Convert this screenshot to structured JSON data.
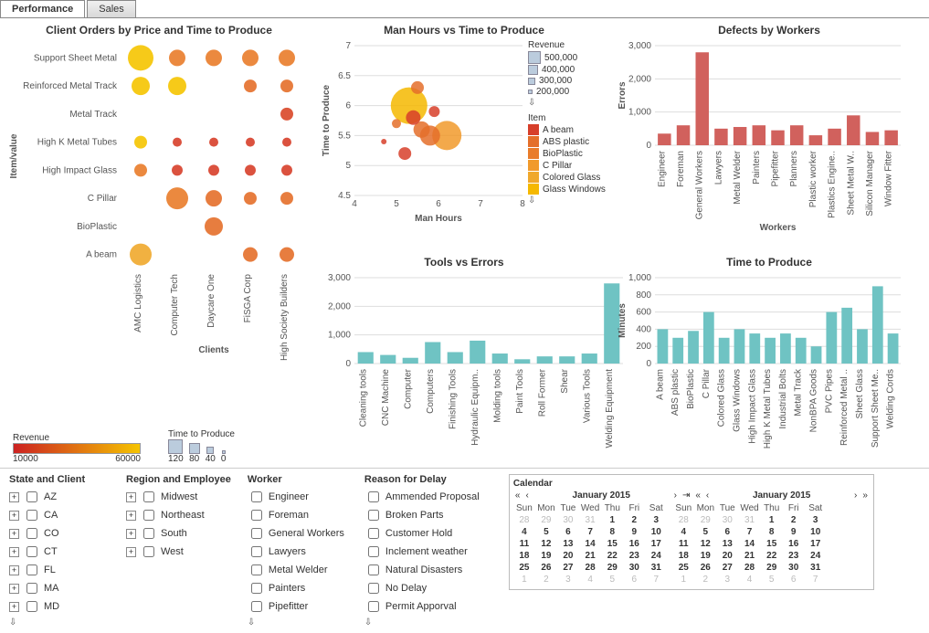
{
  "tabs": {
    "performance": "Performance",
    "sales": "Sales"
  },
  "chart_data": [
    {
      "id": "man_hours_vs_time",
      "type": "scatter",
      "title": "Man Hours vs Time to Produce",
      "xlabel": "Man Hours",
      "ylabel": "Time to Produce",
      "xlim": [
        4,
        8
      ],
      "ylim": [
        4.5,
        7
      ],
      "xticks": [
        4,
        5,
        6,
        7,
        8
      ],
      "yticks": [
        4.5,
        5,
        5.5,
        6,
        6.5,
        7
      ],
      "size_field": "Revenue",
      "size_legend": [
        500000,
        400000,
        300000,
        200000
      ],
      "color_field": "Item",
      "color_legend": [
        "A beam",
        "ABS plastic",
        "BioPlastic",
        "C Pillar",
        "Colored Glass",
        "Glass Windows"
      ],
      "points": [
        {
          "x": 5.3,
          "y": 6.0,
          "r": 20,
          "c": "#f5b800"
        },
        {
          "x": 5.6,
          "y": 5.6,
          "r": 9,
          "c": "#e46f2a"
        },
        {
          "x": 5.4,
          "y": 5.8,
          "r": 8,
          "c": "#d73f2a"
        },
        {
          "x": 5.0,
          "y": 5.7,
          "r": 5,
          "c": "#e46f2a"
        },
        {
          "x": 6.2,
          "y": 5.5,
          "r": 16,
          "c": "#f19a2c"
        },
        {
          "x": 5.8,
          "y": 5.5,
          "r": 11,
          "c": "#e46f2a"
        },
        {
          "x": 5.2,
          "y": 5.2,
          "r": 7,
          "c": "#d73f2a"
        },
        {
          "x": 4.7,
          "y": 5.4,
          "r": 3,
          "c": "#d73f2a"
        },
        {
          "x": 5.5,
          "y": 6.3,
          "r": 7,
          "c": "#e46f2a"
        },
        {
          "x": 5.9,
          "y": 5.9,
          "r": 6,
          "c": "#d73f2a"
        }
      ]
    },
    {
      "id": "defects_by_workers",
      "type": "bar",
      "title": "Defects by Workers",
      "xlabel": "Workers",
      "ylabel": "Errors",
      "ylim": [
        0,
        3000
      ],
      "yticks": [
        0,
        1000,
        2000,
        3000
      ],
      "categories": [
        "Engineer",
        "Foreman",
        "General Workers",
        "Lawyers",
        "Metal Welder",
        "Painters",
        "Pipefitter",
        "Planners",
        "Plastic worker",
        "Plastics Engine..",
        "Sheet Metal W..",
        "Silicon Manager",
        "Window Fitter"
      ],
      "values": [
        350,
        600,
        2800,
        500,
        550,
        600,
        450,
        600,
        300,
        500,
        900,
        400,
        450
      ],
      "color": "#d1615d"
    },
    {
      "id": "client_orders",
      "type": "scatter",
      "title": "Client Orders by Price and Time to Produce",
      "xlabel": "Clients",
      "ylabel": "Item/value",
      "y_categories": [
        "Support Sheet Metal",
        "Reinforced Metal Track",
        "Metal Track",
        "High K Metal Tubes",
        "High Impact Glass",
        "C Pillar",
        "BioPlastic",
        "A beam"
      ],
      "x_categories": [
        "AMC Logistics",
        "Computer Tech",
        "Daycare One",
        "FiSGA Corp",
        "High Society Builders"
      ],
      "points": [
        {
          "yi": 0,
          "xi": 0,
          "r": 14,
          "c": "#f5c400"
        },
        {
          "yi": 0,
          "xi": 1,
          "r": 9,
          "c": "#e97c2a"
        },
        {
          "yi": 0,
          "xi": 2,
          "r": 9,
          "c": "#e97c2a"
        },
        {
          "yi": 0,
          "xi": 3,
          "r": 9,
          "c": "#e97c2a"
        },
        {
          "yi": 0,
          "xi": 4,
          "r": 9,
          "c": "#e97c2a"
        },
        {
          "yi": 1,
          "xi": 0,
          "r": 10,
          "c": "#f5c400"
        },
        {
          "yi": 1,
          "xi": 1,
          "r": 10,
          "c": "#f5c400"
        },
        {
          "yi": 1,
          "xi": 3,
          "r": 7,
          "c": "#e46f2a"
        },
        {
          "yi": 1,
          "xi": 4,
          "r": 7,
          "c": "#e46f2a"
        },
        {
          "yi": 2,
          "xi": 4,
          "r": 7,
          "c": "#d94728"
        },
        {
          "yi": 3,
          "xi": 0,
          "r": 7,
          "c": "#f5c400"
        },
        {
          "yi": 3,
          "xi": 1,
          "r": 5,
          "c": "#d73f2a"
        },
        {
          "yi": 3,
          "xi": 2,
          "r": 5,
          "c": "#d73f2a"
        },
        {
          "yi": 3,
          "xi": 3,
          "r": 5,
          "c": "#d73f2a"
        },
        {
          "yi": 3,
          "xi": 4,
          "r": 5,
          "c": "#d73f2a"
        },
        {
          "yi": 4,
          "xi": 0,
          "r": 7,
          "c": "#e97c2a"
        },
        {
          "yi": 4,
          "xi": 1,
          "r": 6,
          "c": "#d73f2a"
        },
        {
          "yi": 4,
          "xi": 2,
          "r": 6,
          "c": "#d73f2a"
        },
        {
          "yi": 4,
          "xi": 3,
          "r": 6,
          "c": "#d73f2a"
        },
        {
          "yi": 4,
          "xi": 4,
          "r": 6,
          "c": "#d73f2a"
        },
        {
          "yi": 5,
          "xi": 1,
          "r": 12,
          "c": "#e97c2a"
        },
        {
          "yi": 5,
          "xi": 2,
          "r": 9,
          "c": "#e46f2a"
        },
        {
          "yi": 5,
          "xi": 3,
          "r": 7,
          "c": "#e46f2a"
        },
        {
          "yi": 5,
          "xi": 4,
          "r": 7,
          "c": "#e46f2a"
        },
        {
          "yi": 6,
          "xi": 2,
          "r": 10,
          "c": "#e46f2a"
        },
        {
          "yi": 7,
          "xi": 0,
          "r": 12,
          "c": "#f0a82c"
        },
        {
          "yi": 7,
          "xi": 3,
          "r": 8,
          "c": "#e46f2a"
        },
        {
          "yi": 7,
          "xi": 4,
          "r": 8,
          "c": "#e46f2a"
        }
      ],
      "revenue_legend": {
        "label": "Revenue",
        "min": 10000,
        "max": 60000
      },
      "size_legend": {
        "label": "Time to Produce",
        "vals": [
          120,
          80,
          40,
          0
        ]
      }
    },
    {
      "id": "tools_vs_errors",
      "type": "bar",
      "title": "Tools vs Errors",
      "ylim": [
        0,
        3000
      ],
      "yticks": [
        0,
        1000,
        2000,
        3000
      ],
      "categories": [
        "Cleaning tools",
        "CNC Machine",
        "Computer",
        "Computers",
        "Finishing Tools",
        "Hydraulic Equipm..",
        "Molding tools",
        "Paint Tools",
        "Roll Former",
        "Shear",
        "Various Tools",
        "Welding Equipment"
      ],
      "values": [
        400,
        300,
        200,
        750,
        400,
        800,
        350,
        150,
        250,
        250,
        350,
        2800
      ],
      "color": "#6fc3c3"
    },
    {
      "id": "time_to_produce",
      "type": "bar",
      "title": "Time to Produce",
      "ylabel": "Minutes",
      "ylim": [
        0,
        1000
      ],
      "yticks": [
        0,
        200,
        400,
        600,
        800,
        1000
      ],
      "categories": [
        "A beam",
        "ABS plastic",
        "BioPlastic",
        "C Pillar",
        "Colored Glass",
        "Glass Windows",
        "High Impact Glass",
        "High K Metal Tubes",
        "Industrial Bolts",
        "Metal Track",
        "NonBPA Goods",
        "PVC Pipes",
        "Reinforced Metal ..",
        "Sheet Glass",
        "Support Sheet Me..",
        "Welding Cords"
      ],
      "values": [
        400,
        300,
        380,
        600,
        300,
        400,
        350,
        300,
        350,
        300,
        200,
        600,
        650,
        400,
        900,
        350
      ],
      "color": "#6fc3c3"
    }
  ],
  "filters": {
    "state_and_client": {
      "title": "State and Client",
      "items": [
        "AZ",
        "CA",
        "CO",
        "CT",
        "FL",
        "MA",
        "MD"
      ]
    },
    "region_and_employee": {
      "title": "Region and Employee",
      "items": [
        "Midwest",
        "Northeast",
        "South",
        "West"
      ]
    },
    "worker": {
      "title": "Worker",
      "items": [
        "Engineer",
        "Foreman",
        "General Workers",
        "Lawyers",
        "Metal Welder",
        "Painters",
        "Pipefitter"
      ]
    },
    "reason_for_delay": {
      "title": "Reason for Delay",
      "items": [
        "Ammended Proposal",
        "Broken Parts",
        "Customer Hold",
        "Inclement weather",
        "Natural Disasters",
        "No Delay",
        "Permit Apporval"
      ]
    }
  },
  "calendar": {
    "title": "Calendar",
    "month_label": "January 2015",
    "dow": [
      "Sun",
      "Mon",
      "Tue",
      "Wed",
      "Thu",
      "Fri",
      "Sat"
    ],
    "lead": [
      28,
      29,
      30,
      31
    ],
    "days": [
      1,
      2,
      3,
      4,
      5,
      6,
      7,
      8,
      9,
      10,
      11,
      12,
      13,
      14,
      15,
      16,
      17,
      18,
      19,
      20,
      21,
      22,
      23,
      24,
      25,
      26,
      27,
      28,
      29,
      30,
      31
    ],
    "trail": [
      1,
      2,
      3,
      4,
      5,
      6,
      7
    ]
  },
  "legend_labels": {
    "revenue": "Revenue",
    "item": "Item",
    "time_to_produce": "Time to Produce"
  }
}
